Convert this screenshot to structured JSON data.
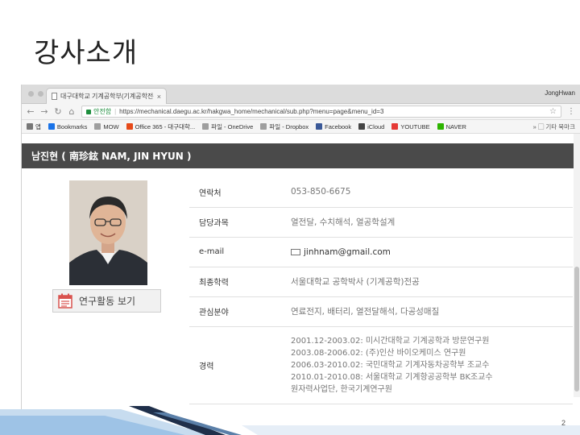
{
  "slide": {
    "title": "강사소개",
    "page_number": "2"
  },
  "browser": {
    "tab_title": "대구대학교 기계공학부(기계공학전공",
    "tab_close": "×",
    "profile_name": "JongHwan",
    "address": {
      "secure_label": "안전함",
      "url": "https://mechanical.daegu.ac.kr/hakgwa_home/mechanical/sub.php?menu=page&menu_id=3"
    },
    "bookmarks": [
      {
        "label": "앱",
        "icon": "apps-icon",
        "color": "#777777"
      },
      {
        "label": "Bookmarks",
        "icon": "star-icon",
        "color": "#1a73e8"
      },
      {
        "label": "MOW",
        "icon": "page-icon",
        "color": "#9e9e9e"
      },
      {
        "label": "Office 365 - 대구대학...",
        "icon": "office-icon",
        "color": "#e64a19"
      },
      {
        "label": "파일 - OneDrive",
        "icon": "page-icon",
        "color": "#9e9e9e"
      },
      {
        "label": "파일 - Dropbox",
        "icon": "page-icon",
        "color": "#9e9e9e"
      },
      {
        "label": "Facebook",
        "icon": "facebook-icon",
        "color": "#3b5998"
      },
      {
        "label": "iCloud",
        "icon": "apple-icon",
        "color": "#444444"
      },
      {
        "label": "YOUTUBE",
        "icon": "youtube-icon",
        "color": "#e53935"
      },
      {
        "label": "NAVER",
        "icon": "naver-icon",
        "color": "#2db400"
      }
    ],
    "bookmarks_more": "» ▢ 기타 북마크"
  },
  "profile": {
    "header": "남진현 ( 南珍鉉 NAM, JIN HYUN )",
    "research_button": "연구활동 보기",
    "rows": [
      {
        "label": "연락처",
        "value": "053-850-6675"
      },
      {
        "label": "담당과목",
        "value": "열전달, 수치해석, 열공학설계"
      },
      {
        "label": "e-mail",
        "value": "jinhnam@gmail.com"
      },
      {
        "label": "최종학력",
        "value": "서울대학교 공학박사 (기계공학)전공"
      },
      {
        "label": "관심분야",
        "value": "연료전지, 배터리, 열전달해석, 다공성매질"
      },
      {
        "label": "경력",
        "lines": [
          "2001.12-2003.02: 미시간대학교 기계공학과 방문연구원",
          "2003.08-2006.02: (주)인산 바이오케미스 연구원",
          "2006.03-2010.02: 국민대학교 기계자동차공학부 조교수",
          "2010.01-2010.08: 서울대학교 기계항공공학부 BK조교수",
          "원자력사업단, 한국기계연구원"
        ]
      }
    ]
  },
  "colors": {
    "header_bar": "#4a4a4a",
    "secure_green": "#1e8e3e",
    "deco_blue": "#9ec3e6",
    "deco_dark": "#1f2f4a"
  }
}
